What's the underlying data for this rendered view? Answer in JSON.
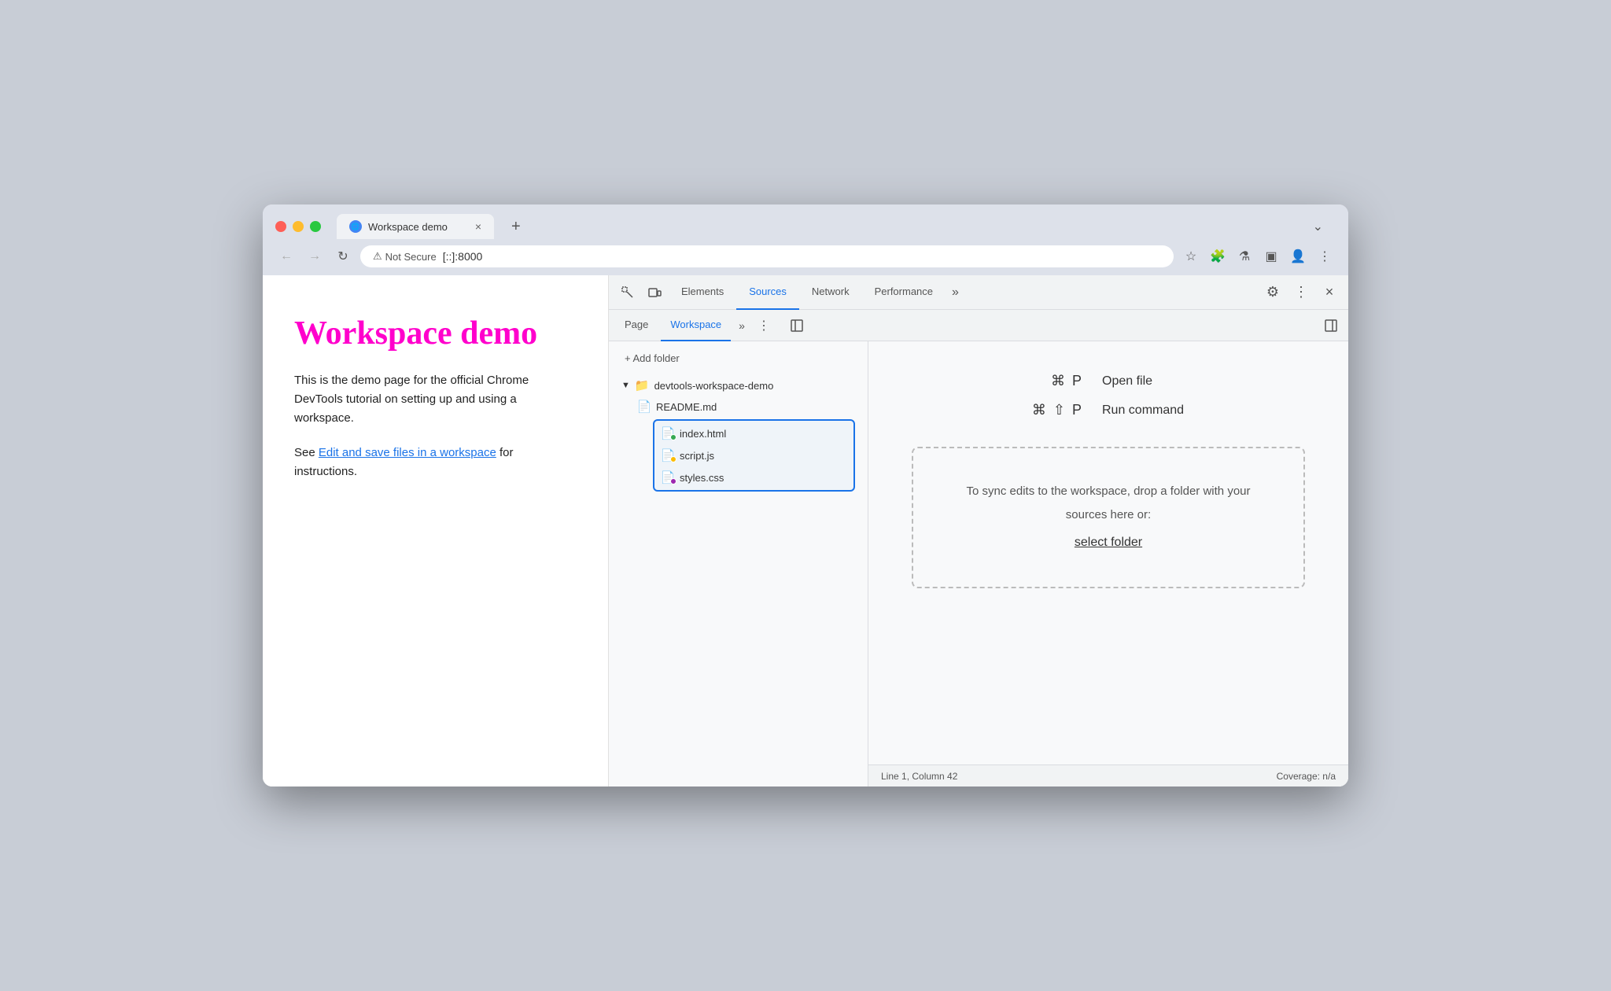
{
  "browser": {
    "tab_title": "Workspace demo",
    "tab_favicon": "🌐",
    "tab_close": "×",
    "tab_new": "+",
    "tab_menu": "⌄",
    "nav_back": "←",
    "nav_forward": "→",
    "nav_refresh": "↻",
    "not_secure": "Not Secure",
    "url": "[::]:8000",
    "addr_star": "☆",
    "addr_extensions": "🧩",
    "addr_labs": "⚗",
    "addr_profile": "👤",
    "addr_menu": "⋮",
    "addr_sidebar": "▣"
  },
  "page": {
    "title": "Workspace demo",
    "body": "This is the demo page for the official Chrome DevTools tutorial on setting up and using a workspace.",
    "see_text": "See ",
    "link_text": "Edit and save files in a workspace",
    "after_link": " for instructions."
  },
  "devtools": {
    "tabs": [
      {
        "label": "Elements",
        "active": false
      },
      {
        "label": "Sources",
        "active": true
      },
      {
        "label": "Network",
        "active": false
      },
      {
        "label": "Performance",
        "active": false
      }
    ],
    "tab_more": "»",
    "settings_icon": "⚙",
    "more_icon": "⋮",
    "close_icon": "×",
    "inspect_icon": "⬚",
    "device_icon": "▭",
    "sources": {
      "sub_tabs": [
        {
          "label": "Page",
          "active": false
        },
        {
          "label": "Workspace",
          "active": true
        }
      ],
      "sub_more": "»",
      "sub_menu": "⋮",
      "breadcrumb_icon": "◫",
      "collapse_icon": "◫"
    },
    "file_tree": {
      "add_folder": "+ Add folder",
      "folder_name": "devtools-workspace-demo",
      "files": [
        {
          "name": "README.md",
          "dot": null
        },
        {
          "name": "index.html",
          "dot": "green"
        },
        {
          "name": "script.js",
          "dot": "orange"
        },
        {
          "name": "styles.css",
          "dot": "purple"
        }
      ]
    },
    "editor": {
      "shortcut1_keys": "⌘ P",
      "shortcut1_label": "Open file",
      "shortcut2_keys": "⌘ ⇧ P",
      "shortcut2_label": "Run command",
      "drop_zone_text": "To sync edits to the workspace, drop a folder with your sources here or:",
      "select_folder": "select folder"
    },
    "status": {
      "position": "Line 1, Column 42",
      "coverage": "Coverage: n/a"
    }
  }
}
